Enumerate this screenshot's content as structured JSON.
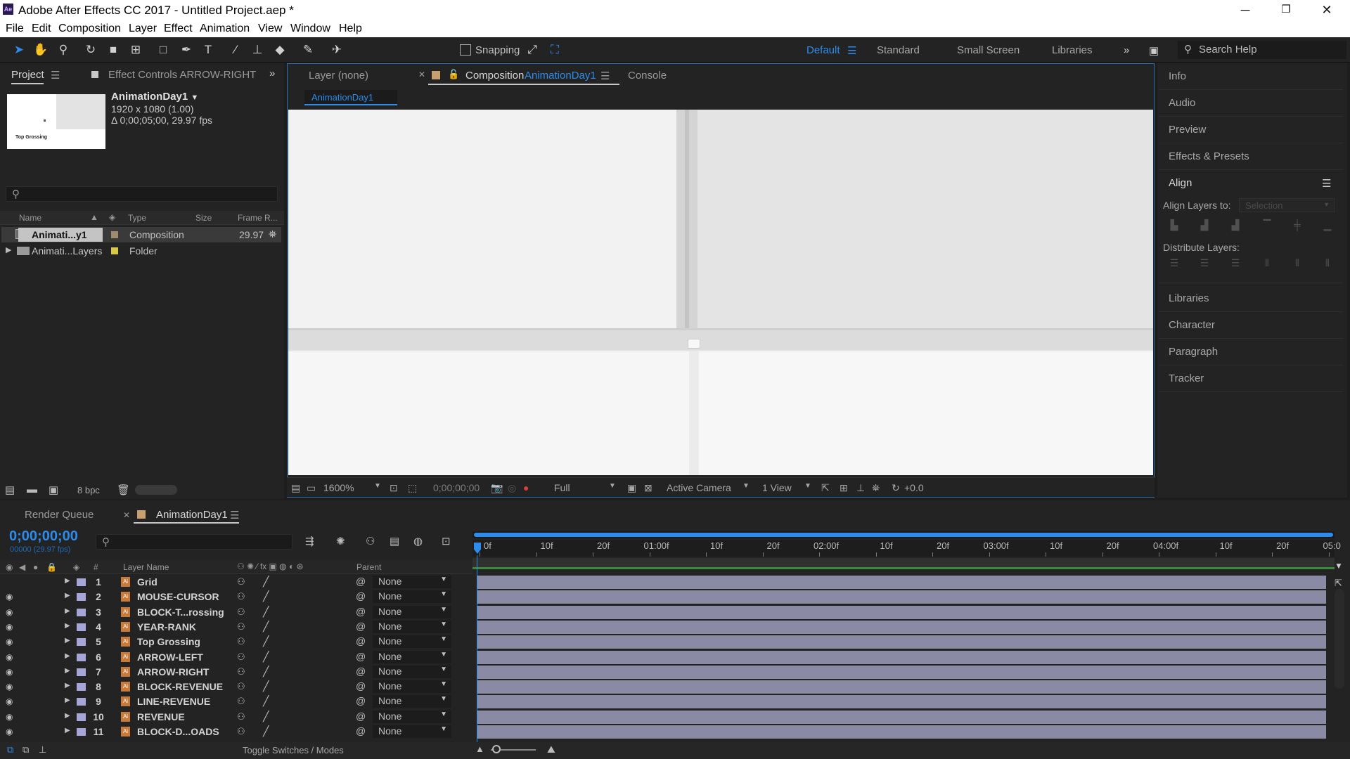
{
  "window": {
    "title": "Adobe After Effects CC 2017 - Untitled Project.aep *",
    "app_icon": "Ae",
    "minimize": "─",
    "restore": "❐",
    "close": "✕"
  },
  "menu": [
    "File",
    "Edit",
    "Composition",
    "Layer",
    "Effect",
    "Animation",
    "View",
    "Window",
    "Help"
  ],
  "toolbar": {
    "snapping": "Snapping",
    "workspaces": [
      "Default",
      "Standard",
      "Small Screen",
      "Libraries"
    ],
    "search_help": "Search Help",
    "icons": [
      "selection-icon",
      "hand-icon",
      "zoom-icon",
      "rotate-icon",
      "camera-icon",
      "pan-behind-icon",
      "rectangle-icon",
      "pen-icon",
      "type-icon",
      "brush-icon",
      "clone-stamp-icon",
      "eraser-icon",
      "roto-brush-icon",
      "puppet-pin-icon"
    ]
  },
  "project_panel": {
    "tab_project": "Project",
    "tab_effect_controls": "Effect Controls ARROW-RIGHT",
    "comp_name": "AnimationDay1",
    "comp_size": "1920 x 1080 (1.00)",
    "comp_duration": "Δ 0;00;05;00, 29.97 fps",
    "thumb_label": "Top Grossing",
    "columns": [
      "Name",
      "Type",
      "Size",
      "Frame R..."
    ],
    "rows": [
      {
        "name": "Animati...y1",
        "type": "Composition",
        "size": "",
        "frame_rate": "29.97",
        "swatch": "#a08a6e"
      },
      {
        "name": "Animati...Layers",
        "type": "Folder",
        "size": "",
        "frame_rate": "",
        "swatch": "#d8c84a"
      }
    ],
    "bpc": "8 bpc"
  },
  "viewer": {
    "tab_layer": "Layer  (none)",
    "tab_composition_prefix": "Composition",
    "tab_composition_name": "AnimationDay1",
    "tab_console": "Console",
    "comp_crumb": "AnimationDay1",
    "zoom": "1600%",
    "timecode": "0;00;00;00",
    "resolution": "Full",
    "camera": "Active Camera",
    "views": "1 View",
    "exposure": "+0.0"
  },
  "right_panels": {
    "items_top": [
      "Info",
      "Audio",
      "Preview",
      "Effects & Presets"
    ],
    "align_title": "Align",
    "align_layers_to": "Align Layers to:",
    "align_selection": "Selection",
    "distribute_layers": "Distribute Layers:",
    "items_bottom": [
      "Libraries",
      "Character",
      "Paragraph",
      "Tracker"
    ]
  },
  "timeline": {
    "tab_render_queue": "Render Queue",
    "tab_comp": "AnimationDay1",
    "timecode": "0;00;00;00",
    "fps_sub": "00000 (29.97 fps)",
    "col_layer_name": "Layer Name",
    "col_hash": "#",
    "col_parent": "Parent",
    "ruler": [
      "0f",
      "10f",
      "20f",
      "01:00f",
      "10f",
      "20f",
      "02:00f",
      "10f",
      "20f",
      "03:00f",
      "10f",
      "20f",
      "04:00f",
      "10f",
      "20f",
      "05:0"
    ],
    "layers": [
      {
        "num": "1",
        "name": "Grid",
        "parent": "None",
        "visible": false
      },
      {
        "num": "2",
        "name": "MOUSE-CURSOR",
        "parent": "None",
        "visible": true
      },
      {
        "num": "3",
        "name": "BLOCK-T...rossing",
        "parent": "None",
        "visible": true
      },
      {
        "num": "4",
        "name": "YEAR-RANK",
        "parent": "None",
        "visible": true
      },
      {
        "num": "5",
        "name": "Top Grossing",
        "parent": "None",
        "visible": true
      },
      {
        "num": "6",
        "name": "ARROW-LEFT",
        "parent": "None",
        "visible": true
      },
      {
        "num": "7",
        "name": "ARROW-RIGHT",
        "parent": "None",
        "visible": true
      },
      {
        "num": "8",
        "name": "BLOCK-REVENUE",
        "parent": "None",
        "visible": true
      },
      {
        "num": "9",
        "name": "LINE-REVENUE",
        "parent": "None",
        "visible": true
      },
      {
        "num": "10",
        "name": "REVENUE",
        "parent": "None",
        "visible": true
      },
      {
        "num": "11",
        "name": "BLOCK-D...OADS",
        "parent": "None",
        "visible": true
      }
    ],
    "toggle_switches": "Toggle Switches / Modes"
  },
  "colors": {
    "accent": "#2d8ceb",
    "panel": "#232323",
    "layer_bar": "#8a8aa5",
    "label_lavender": "#a5a5d8"
  }
}
